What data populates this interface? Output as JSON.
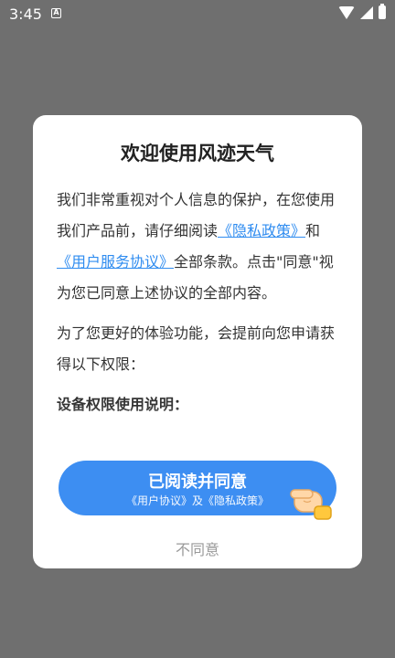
{
  "statusbar": {
    "time": "3:45",
    "notif_icon": "A"
  },
  "dialog": {
    "title": "欢迎使用风迹天气",
    "intro_part1": "我们非常重视对个人信息的保护，在您使用我们产品前，请仔细阅读",
    "privacy_link": "《隐私政策》",
    "and": "和",
    "service_link": "《用户服务协议》",
    "intro_part2": "全部条款。点击\"同意\"视为您已同意上述协议的全部内容。",
    "para2": "为了您更好的体验功能，会提前向您申请获得以下权限：",
    "para3": "设备权限使用说明：",
    "agree_label": "已阅读并同意",
    "agree_sub": "《用户协议》及《隐私政策》",
    "disagree_label": "不同意"
  },
  "colors": {
    "accent": "#3d8ef2",
    "link": "#2f8cf0",
    "overlay": "#6f6f6f"
  }
}
